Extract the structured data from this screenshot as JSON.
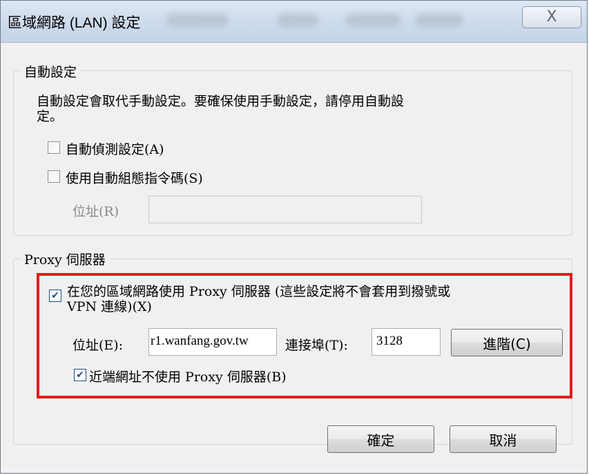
{
  "window": {
    "title": "區域網路 (LAN) 設定",
    "close_symbol": "X"
  },
  "auto_config": {
    "group_label": "自動設定",
    "description_line1": "自動設定會取代手動設定。要確保使用手動設定，請停用自動設",
    "description_line2": "定。",
    "auto_detect_label": "自動偵測設定(A)",
    "auto_detect_checked": false,
    "use_script_label": "使用自動組態指令碼(S)",
    "use_script_checked": false,
    "address_label": "位址(R)",
    "address_value": ""
  },
  "proxy": {
    "group_label": "Proxy 伺服器",
    "use_proxy_line1": "在您的區域網路使用 Proxy 伺服器 (這些設定將不會套用到撥號或",
    "use_proxy_line2": "VPN 連線)(X)",
    "use_proxy_checked": true,
    "address_label": "位址(E):",
    "address_value": "r1.wanfang.gov.tw",
    "port_label": "連接埠(T):",
    "port_value": "3128",
    "advanced_label": "進階(C)",
    "bypass_label": "近端網址不使用 Proxy 伺服器(B)",
    "bypass_checked": true
  },
  "buttons": {
    "ok_label": "確定",
    "cancel_label": "取消"
  },
  "colors": {
    "highlight": "#e41b1b",
    "titlebar": "#cfdcec"
  }
}
